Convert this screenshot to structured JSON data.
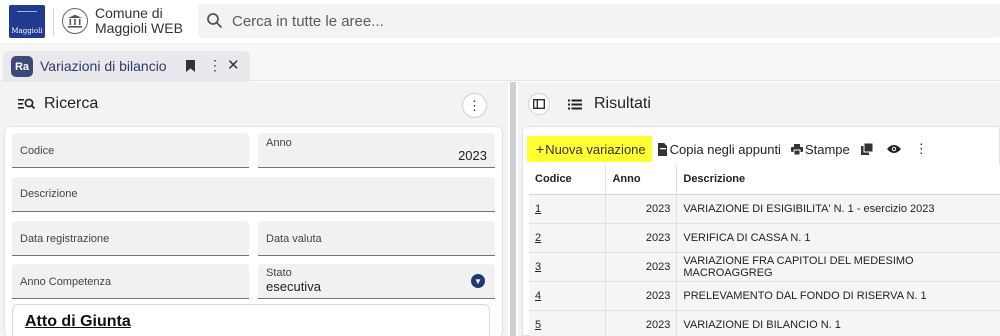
{
  "header": {
    "logo_text": "Maggioli",
    "app_name_line1": "Comune di",
    "app_name_line2": "Maggioli WEB",
    "search_placeholder": "Cerca in tutte le aree..."
  },
  "tab": {
    "icon_text": "Ra",
    "label": "Variazioni di bilancio"
  },
  "search_panel": {
    "title": "Ricerca",
    "fields": {
      "codice": {
        "label": "Codice",
        "value": ""
      },
      "anno": {
        "label": "Anno",
        "value": "2023"
      },
      "descrizione": {
        "label": "Descrizione",
        "value": ""
      },
      "data_registrazione": {
        "label": "Data registrazione",
        "value": ""
      },
      "data_valuta": {
        "label": "Data valuta",
        "value": ""
      },
      "anno_competenza": {
        "label": "Anno Competenza",
        "value": ""
      },
      "stato": {
        "label": "Stato",
        "value": "esecutiva"
      }
    },
    "card_title": "Atto di Giunta"
  },
  "results_panel": {
    "title": "Risultati",
    "toolbar": {
      "new_label": "Nuova variazione",
      "copy_label": "Copia negli appunti",
      "print_label": "Stampe"
    },
    "columns": [
      "Codice",
      "Anno",
      "Descrizione"
    ],
    "rows": [
      {
        "codice": "1",
        "anno": "2023",
        "descrizione": "VARIAZIONE DI ESIGIBILITA' N. 1 - esercizio 2023"
      },
      {
        "codice": "2",
        "anno": "2023",
        "descrizione": "VERIFICA DI CASSA N. 1"
      },
      {
        "codice": "3",
        "anno": "2023",
        "descrizione": "VARIAZIONE FRA CAPITOLI DEL MEDESIMO MACROAGGREG"
      },
      {
        "codice": "4",
        "anno": "2023",
        "descrizione": "PRELEVAMENTO DAL FONDO DI RISERVA N. 1"
      },
      {
        "codice": "5",
        "anno": "2023",
        "descrizione": "VARIAZIONE DI BILANCIO N. 1"
      }
    ]
  },
  "colors": {
    "brand_blue": "#1f3a8f",
    "highlight_yellow": "#ffff33",
    "tab_accent": "#3b4a7a"
  }
}
